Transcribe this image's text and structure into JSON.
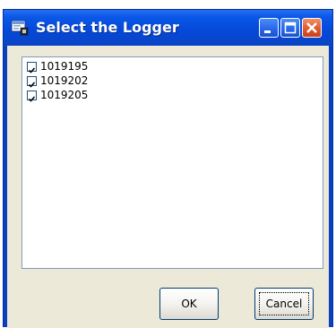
{
  "window": {
    "title": "Select the Logger",
    "title_icon": "app-icon",
    "controls": [
      "minimize-icon",
      "maximize-icon",
      "close-icon"
    ]
  },
  "list": {
    "items": [
      {
        "label": "1019195",
        "checked": true
      },
      {
        "label": "1019202",
        "checked": true
      },
      {
        "label": "1019205",
        "checked": true
      }
    ]
  },
  "buttons": {
    "ok": "OK",
    "cancel": "Cancel"
  },
  "colors": {
    "titlebar": "#0548d8",
    "client": "#ece9d8",
    "close_button": "#e05a2c"
  }
}
